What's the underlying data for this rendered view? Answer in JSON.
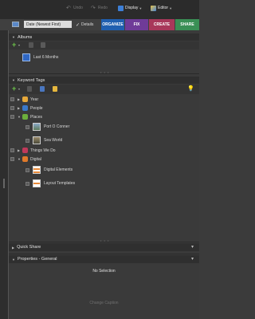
{
  "topbar": {
    "undo": "Undo",
    "redo": "Redo",
    "display": "Display",
    "editor": "Editor"
  },
  "row2": {
    "sort": "Date (Newest First)",
    "details": "Details",
    "tabs": [
      {
        "label": "ORGANIZE",
        "color": "#1f5fb0"
      },
      {
        "label": "FIX",
        "color": "#7b3fa0"
      },
      {
        "label": "CREATE",
        "color": "#b23a5c"
      },
      {
        "label": "SHARE",
        "color": "#3f9a5a"
      }
    ]
  },
  "albums": {
    "title": "Albums",
    "items": [
      {
        "label": "Last 6 Months"
      }
    ]
  },
  "keyword_tags": {
    "title": "Keyword Tags",
    "items": [
      {
        "label": "Year",
        "color": "#e6a83a"
      },
      {
        "label": "People",
        "color": "#3a78c8"
      },
      {
        "label": "Places",
        "color": "#6cae3c"
      },
      {
        "label": "Port O Conner"
      },
      {
        "label": "Sea World"
      },
      {
        "label": "Things We Do",
        "color": "#c0395a"
      },
      {
        "label": "Digital",
        "color": "#e07a2a"
      },
      {
        "label": "Digital Elements"
      },
      {
        "label": "Layout Templates"
      }
    ]
  },
  "quick_share": {
    "title": "Quick Share"
  },
  "properties": {
    "title": "Properties - General",
    "status": "No Selection",
    "change_caption": "Change Caption"
  }
}
